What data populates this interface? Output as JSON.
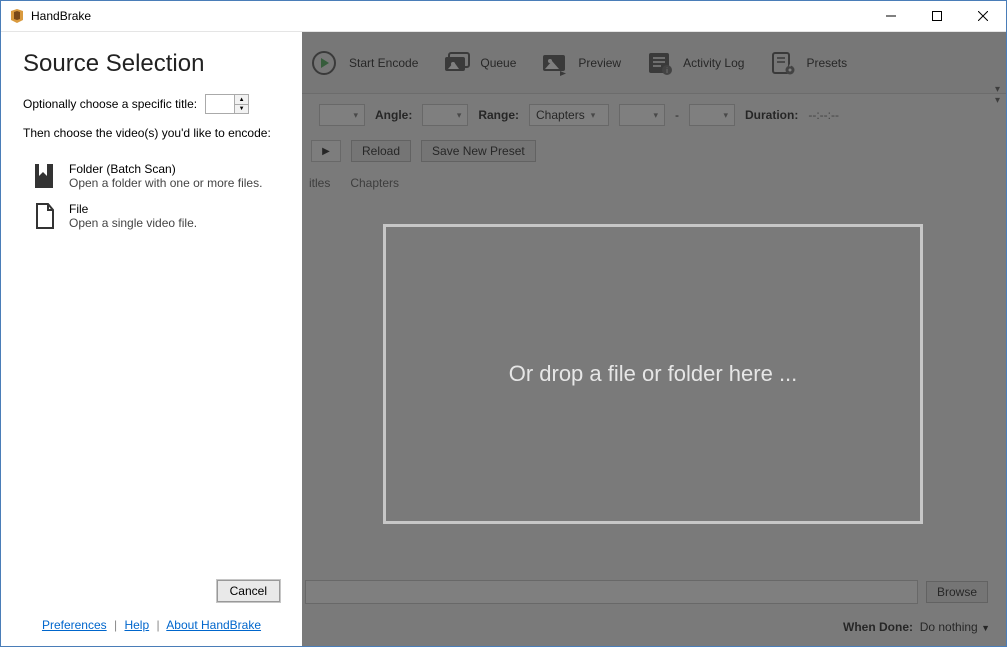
{
  "window": {
    "title": "HandBrake"
  },
  "sidebar": {
    "heading": "Source Selection",
    "opt_title_label": "Optionally choose a specific title:",
    "opt_title_value": "",
    "then_label": "Then choose the video(s) you'd like to encode:",
    "options": [
      {
        "label": "Folder (Batch Scan)",
        "desc": "Open a folder with one or more files."
      },
      {
        "label": "File",
        "desc": "Open a single video file."
      }
    ],
    "cancel": "Cancel",
    "links": {
      "preferences": "Preferences",
      "help": "Help",
      "about": "About HandBrake"
    }
  },
  "toolbar": {
    "start_encode": "Start Encode",
    "queue": "Queue",
    "preview": "Preview",
    "activity_log": "Activity Log",
    "presets": "Presets"
  },
  "summary": {
    "angle_label": "Angle:",
    "range_label": "Range:",
    "range_mode": "Chapters",
    "range_sep": "-",
    "duration_label": "Duration:",
    "duration_value": "--:--:--"
  },
  "preset_row": {
    "reload": "Reload",
    "save_new_preset": "Save New Preset"
  },
  "tabs": {
    "subtitles": "itles",
    "chapters": "Chapters"
  },
  "dropzone": "Or drop a file or folder here ...",
  "save_area": {
    "browse": "Browse"
  },
  "footer": {
    "when_done_label": "When Done:",
    "when_done_value": "Do nothing"
  }
}
